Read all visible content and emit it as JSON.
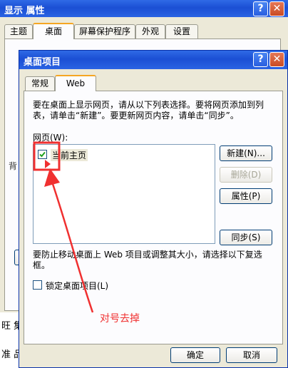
{
  "back_window": {
    "title": "显示 属性",
    "help_label": "?",
    "close_label": "✕",
    "tabs": [
      "主题",
      "桌面",
      "屏幕保护程序",
      "外观",
      "设置"
    ],
    "active_tab": 1,
    "edge_chars": [
      "背",
      "旺 集",
      "准 品"
    ]
  },
  "dialog": {
    "title": "桌面项目",
    "help_label": "?",
    "close_label": "✕",
    "tabs": [
      "常规",
      "Web"
    ],
    "active_tab": 1,
    "description": "要在桌面上显示网页，请从以下列表选择。要将网页添加到列表，请单击“新建”。要更新网页内容，请单击“同步”。",
    "list_label": "网页(W):",
    "list_items": [
      {
        "label": "当前主页",
        "checked": true
      }
    ],
    "buttons": {
      "new": "新建(N)...",
      "delete": "删除(D)",
      "properties": "属性(P)",
      "sync": "同步(S)"
    },
    "lock_description": "要防止移动桌面上 Web 项目或调整其大小，请选择以下复选框。",
    "lock_label": "锁定桌面项目(L)",
    "lock_checked": false,
    "ok_label": "确定",
    "cancel_label": "取消"
  },
  "annotation": {
    "text": "对号去掉",
    "color": "#f03030"
  }
}
